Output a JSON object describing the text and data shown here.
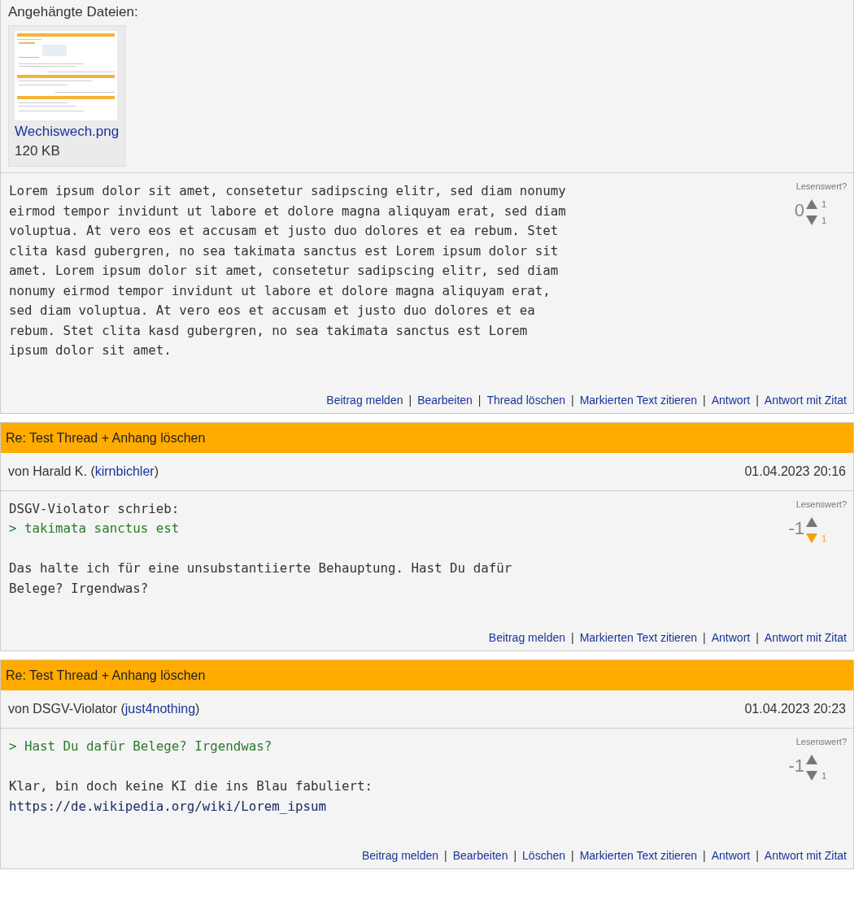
{
  "posts": [
    {
      "attachments": {
        "label": "Angehängte Dateien:",
        "files": [
          {
            "name": "Wechiswech.png",
            "size": "120 KB"
          }
        ]
      },
      "body": [
        {
          "kind": "text",
          "text": "Lorem ipsum dolor sit amet, consetetur sadipscing elitr, sed diam nonumy"
        },
        {
          "kind": "text",
          "text": "eirmod tempor invidunt ut labore et dolore magna aliquyam erat, sed diam"
        },
        {
          "kind": "text",
          "text": "voluptua. At vero eos et accusam et justo duo dolores et ea rebum. Stet"
        },
        {
          "kind": "text",
          "text": "clita kasd gubergren, no sea takimata sanctus est Lorem ipsum dolor sit"
        },
        {
          "kind": "text",
          "text": "amet. Lorem ipsum dolor sit amet, consetetur sadipscing elitr, sed diam"
        },
        {
          "kind": "text",
          "text": "nonumy eirmod tempor invidunt ut labore et dolore magna aliquyam erat,"
        },
        {
          "kind": "text",
          "text": "sed diam voluptua. At vero eos et accusam et justo duo dolores et ea"
        },
        {
          "kind": "text",
          "text": "rebum. Stet clita kasd gubergren, no sea takimata sanctus est Lorem"
        },
        {
          "kind": "text",
          "text": "ipsum dolor sit amet."
        }
      ],
      "rating": {
        "label": "Lesenswert?",
        "score": "0",
        "up_count": "1",
        "down_count": "1",
        "voted_up": false,
        "voted_down": false
      },
      "separator": "|",
      "actions": [
        "Beitrag melden",
        "Bearbeiten",
        "Thread löschen",
        "Markierten Text zitieren",
        "Antwort",
        "Antwort mit Zitat"
      ]
    },
    {
      "title": "Re: Test Thread + Anhang löschen",
      "author": {
        "prefix": "von Harald K. (",
        "user": "kirnbichler",
        "suffix": ")"
      },
      "date": "01.04.2023 20:16",
      "body": [
        {
          "kind": "text",
          "text": "DSGV-Violator schrieb:"
        },
        {
          "kind": "quote",
          "text": "> takimata sanctus est"
        },
        {
          "kind": "gap"
        },
        {
          "kind": "text",
          "text": "Das halte ich für eine unsubstantiierte Behauptung. Hast Du dafür"
        },
        {
          "kind": "text",
          "text": "Belege? Irgendwas?"
        }
      ],
      "rating": {
        "label": "Lesenswert?",
        "score": "-1",
        "down_count": "1",
        "voted_up": false,
        "voted_down": true
      },
      "separator": "|",
      "actions": [
        "Beitrag melden",
        "Markierten Text zitieren",
        "Antwort",
        "Antwort mit Zitat"
      ]
    },
    {
      "title": "Re: Test Thread + Anhang löschen",
      "author": {
        "prefix": "von DSGV-Violator (",
        "user": "just4nothing",
        "suffix": ")"
      },
      "date": "01.04.2023 20:23",
      "body": [
        {
          "kind": "quote",
          "text": "> Hast Du dafür Belege? Irgendwas?"
        },
        {
          "kind": "gap"
        },
        {
          "kind": "text",
          "text": "Klar, bin doch keine KI die ins Blau fabuliert:"
        },
        {
          "kind": "link",
          "text": "https://de.wikipedia.org/wiki/Lorem_ipsum"
        }
      ],
      "rating": {
        "label": "Lesenswert?",
        "score": "-1",
        "down_count": "1",
        "voted_up": false,
        "voted_down": false
      },
      "separator": "|",
      "actions": [
        "Beitrag melden",
        "Bearbeiten",
        "Löschen",
        "Markierten Text zitieren",
        "Antwort",
        "Antwort mit Zitat"
      ]
    }
  ]
}
